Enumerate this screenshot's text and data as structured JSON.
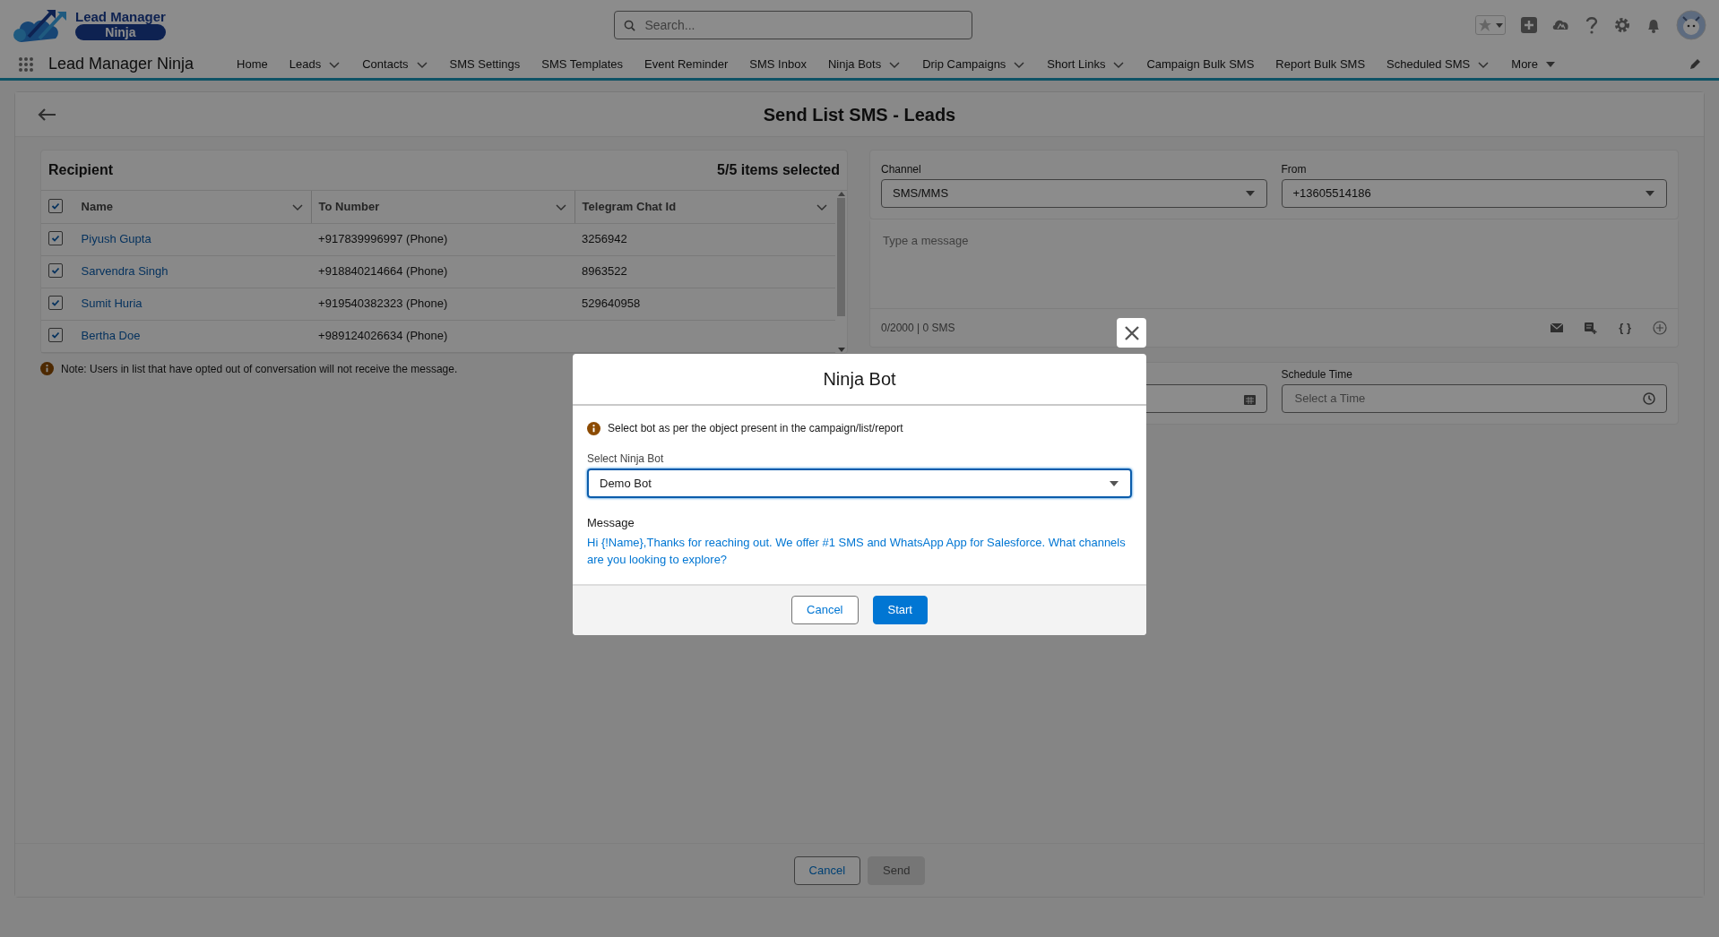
{
  "app": {
    "logo_top": "Lead Manager",
    "logo_bottom": "Ninja",
    "name": "Lead Manager Ninja"
  },
  "search": {
    "placeholder": "Search..."
  },
  "nav": [
    {
      "label": "Home",
      "kind": "link"
    },
    {
      "label": "Leads",
      "kind": "dropdown"
    },
    {
      "label": "Contacts",
      "kind": "dropdown"
    },
    {
      "label": "SMS Settings",
      "kind": "link"
    },
    {
      "label": "SMS Templates",
      "kind": "link"
    },
    {
      "label": "Event Reminder",
      "kind": "link"
    },
    {
      "label": "SMS Inbox",
      "kind": "link"
    },
    {
      "label": "Ninja Bots",
      "kind": "dropdown"
    },
    {
      "label": "Drip Campaigns",
      "kind": "dropdown"
    },
    {
      "label": "Short Links",
      "kind": "dropdown"
    },
    {
      "label": "Campaign Bulk SMS",
      "kind": "link"
    },
    {
      "label": "Report Bulk SMS",
      "kind": "link"
    },
    {
      "label": "Scheduled SMS",
      "kind": "dropdown"
    },
    {
      "label": "More",
      "kind": "overflow"
    }
  ],
  "page": {
    "title": "Send List SMS - Leads"
  },
  "recipients": {
    "title": "Recipient",
    "count": "5/5 items selected",
    "all_checked": true,
    "columns": [
      "Name",
      "To Number",
      "Telegram Chat Id"
    ],
    "rows": [
      {
        "name": "Piyush Gupta",
        "number": "+917839996997 (Phone)",
        "chat_id": "3256942",
        "checked": true
      },
      {
        "name": "Sarvendra Singh",
        "number": "+918840214664 (Phone)",
        "chat_id": "8963522",
        "checked": true
      },
      {
        "name": "Sumit Huria",
        "number": "+919540382323 (Phone)",
        "chat_id": "529640958",
        "checked": true
      },
      {
        "name": "Bertha Doe",
        "number": "+989124026634 (Phone)",
        "checked": true
      }
    ],
    "note": "Note: Users in list that have opted out of conversation will not receive the message."
  },
  "compose": {
    "channel": {
      "label": "Channel",
      "value": "SMS/MMS"
    },
    "from": {
      "label": "From",
      "value": "+13605514186"
    },
    "message": {
      "placeholder": "Type a message"
    },
    "counter": "0/2000 | 0 SMS",
    "merge_field": "{ }",
    "schedule_time": {
      "label": "Schedule Time",
      "placeholder": "Select a Time"
    }
  },
  "footer": {
    "cancel": "Cancel",
    "send": {
      "label": "Send",
      "disabled": true
    }
  },
  "modal": {
    "title": "Ninja Bot",
    "info": "Select bot as per the object present in the campaign/list/report",
    "select": {
      "label": "Select Ninja Bot",
      "value": "Demo Bot"
    },
    "message_label": "Message",
    "message": "Hi {!Name},Thanks for reaching out. We offer #1 SMS and WhatsApp App for Salesforce. What channels are you looking to explore?",
    "buttons": [
      {
        "label": "Cancel",
        "kind": "neutral"
      },
      {
        "label": "Start",
        "kind": "brand"
      }
    ]
  }
}
